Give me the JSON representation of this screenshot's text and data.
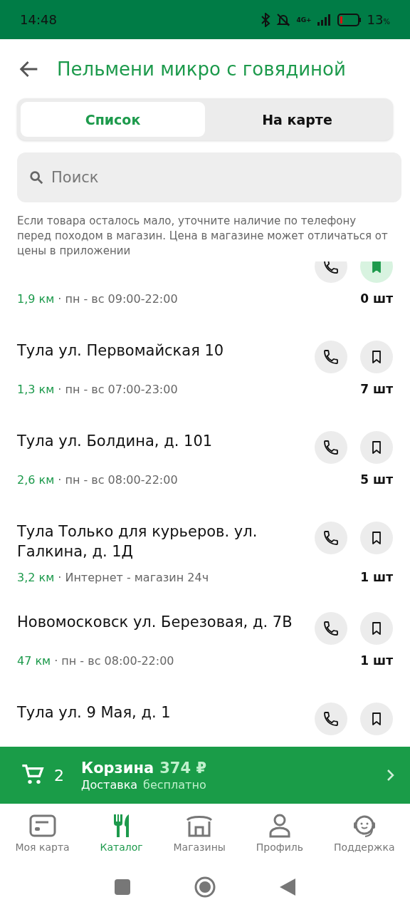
{
  "status_bar": {
    "time": "14:48",
    "network": "4G+",
    "battery": "13",
    "battery_unit": "%"
  },
  "header": {
    "title": "Пельмени микро с говядиной"
  },
  "tabs": [
    {
      "label": "Список",
      "selected": true
    },
    {
      "label": "На карте",
      "selected": false
    }
  ],
  "search": {
    "placeholder": "Поиск"
  },
  "notice": "Если товара осталось мало, уточните наличие по телефону перед походом в магазин. Цена в магазине может отличаться от цены в приложении",
  "stores": [
    {
      "distance": "1,9 км",
      "hours": "· пн - вс 09:00-22:00",
      "stock": "0 шт",
      "saved": true
    },
    {
      "name": "Тула ул. Первомайская 10",
      "distance": "1,3 км",
      "hours": "· пн - вс 07:00-23:00",
      "stock": "7 шт",
      "saved": false
    },
    {
      "name": "Тула ул. Болдина, д. 101",
      "distance": "2,6 км",
      "hours": "· пн - вс 08:00-22:00",
      "stock": "5 шт",
      "saved": false
    },
    {
      "name": "Тула Только для курьеров. ул. Галкина, д. 1Д",
      "distance": "3,2 км",
      "hours": "· Интернет - магазин 24ч",
      "stock": "1 шт",
      "saved": false
    },
    {
      "name": "Новомосковск ул. Березовая, д. 7В",
      "distance": "47 км",
      "hours": "· пн - вс 08:00-22:00",
      "stock": "1 шт",
      "saved": false
    },
    {
      "name": "Тула ул. 9 Мая, д. 1",
      "saved": false
    }
  ],
  "cart": {
    "count": "2",
    "title": "Корзина",
    "total": "374 ₽",
    "delivery_label": "Доставка",
    "delivery_value": "бесплатно"
  },
  "bottom_nav": [
    {
      "label": "Моя карта",
      "kind": "card",
      "selected": false
    },
    {
      "label": "Каталог",
      "kind": "catalog",
      "selected": true
    },
    {
      "label": "Магазины",
      "kind": "store",
      "selected": false
    },
    {
      "label": "Профиль",
      "kind": "profile",
      "selected": false
    },
    {
      "label": "Поддержка",
      "kind": "support",
      "selected": false
    }
  ]
}
